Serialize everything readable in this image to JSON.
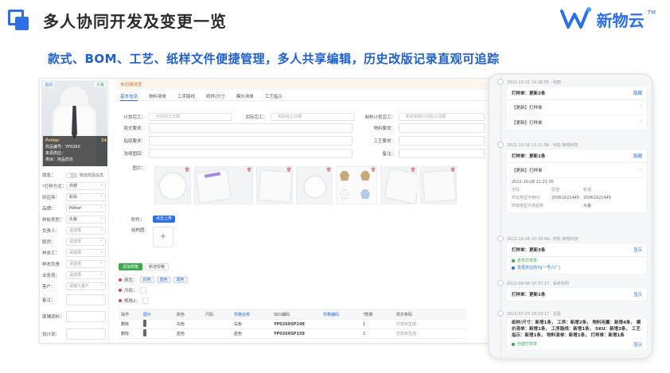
{
  "slide": {
    "title": "多人协同开发及变更一览",
    "subtitle": "款式、BOM、工艺、纸样文件便捷管理，多人共享编辑，历史改版记录直观可追踪",
    "brand": "新物云",
    "brand_tm": "TM"
  },
  "product": {
    "badge_left": "运动",
    "badge_right": "头板",
    "brand_line": "Potter",
    "brand_code": "34",
    "info_lines": [
      "样品编号：YP0260",
      "来源供应：",
      "类目：商品样衣"
    ]
  },
  "left_fields": {
    "switch_label": "修改样品信息",
    "rows": [
      {
        "label": "加急：",
        "value": ""
      },
      {
        "label": "打样方式：",
        "value": "外部"
      },
      {
        "label": "供应商：",
        "value": "彩尚"
      },
      {
        "label": "品牌：",
        "value": "Potter"
      },
      {
        "label": "样板类型：",
        "value": "头板"
      },
      {
        "label": "负责人：",
        "value": "请选择"
      },
      {
        "label": "版师：",
        "value": "请选择"
      },
      {
        "label": "样衣工：",
        "value": "请选择"
      },
      {
        "label": "样衣负责",
        "value": "请选择"
      },
      {
        "label": "业务员：",
        "value": "请选择"
      },
      {
        "label": "客户：",
        "value": "请输入客户"
      },
      {
        "label": "备注：",
        "value": ""
      },
      {
        "label": "面辅资料：",
        "value": ""
      },
      {
        "label": "设计说：",
        "value": ""
      }
    ]
  },
  "main": {
    "draft_notice": "未创建进度",
    "tabs": [
      "基本信息",
      "物料清单",
      "工序路线",
      "纸样/尺寸",
      "模价清单",
      "工艺指示"
    ],
    "form": {
      "plan_finish_label": "计划完工：",
      "plan_finish_placeholder": "计划完工日期",
      "actual_finish_label": "实际完工：",
      "actual_finish_placeholder": "实际完工日期",
      "make_plan_label": "制样计划完工：",
      "make_plan_placeholder": "制定制样计划完工日期",
      "style_req_label": "款式要求：",
      "material_req_label": "物料要求：",
      "pattern_req_label": "贴版要求：",
      "craft_req_label": "工艺要求：",
      "wash_label": "洗唛图回：",
      "remark_label": "备注：",
      "image_label": "图片：",
      "attach_label": "附件：",
      "upload_btn": "点击上传",
      "struct_label": "结构图："
    },
    "spec_tabs": [
      "添加规格",
      "新增规格"
    ],
    "spec_lines": [
      {
        "label": "颜色：",
        "chips": [
          "白色",
          "蓝色",
          "黑色"
        ]
      },
      {
        "label": "尺码：",
        "chips": []
      },
      {
        "label": "规格2：",
        "chips": []
      }
    ],
    "table": {
      "headers": [
        "操作",
        "图片",
        "颜色",
        "尺码",
        "规格名称",
        "SKU编码",
        "规格编码",
        "*数量",
        "样衣条码"
      ],
      "rows": [
        [
          "删除",
          "",
          "白色",
          "",
          "白色",
          "YP0260SP248",
          "",
          "1",
          "打样未生成"
        ],
        [
          "删除",
          "",
          "蓝色",
          "",
          "蓝色",
          "YP0260SP159",
          "",
          "1",
          "打样未生成"
        ]
      ]
    }
  },
  "history": {
    "entries": [
      {
        "date": "2022-10-31 14:38:05 · 张丽",
        "title": "打样单：更新2条",
        "action": "隐藏",
        "items": [
          "【更新】打样单",
          "【更新】打样单"
        ]
      },
      {
        "date": "2022-10-28 11:21:06 · 何松 新物科技",
        "title": "打样单：更新1条",
        "action": "隐藏",
        "item": "【更新】打样单",
        "time": "2022-10-28 11:21:05",
        "kv": [
          [
            "字段",
            "原值",
            "新值"
          ],
          [
            "样衣类型字典ID",
            "25061821440",
            "25061821440"
          ],
          [
            "样板类型字典名称",
            "",
            "头板"
          ]
        ]
      },
      {
        "date": "2022-10-28 10:39:09 · 何松 新物科技",
        "title": "打样单：更新3条",
        "action": "显示",
        "notes": [
          "发布打样单",
          "变更供应商为[一号六厂]"
        ]
      },
      {
        "date": "2022-08-08 10:37:17 · 系统实例",
        "title": "打样单：更新1条",
        "action": "显示"
      },
      {
        "date": "2022-07-29 18:33:17 · 且盈",
        "summary": "纸样/尺寸：新增1条， 工序：新增2条， 物料用量：新增4条， 模价清单：新增1条， 工序路线：新增1条， SKU：新增2条， 工艺指示：新增1条， 物料清单：新增1条， 打样单：新增1条",
        "action": "显示",
        "note": "创建打样单"
      }
    ]
  },
  "colors": {
    "accent": "#2c6fe8",
    "green": "#3aa84b",
    "red": "#e04545",
    "orange": "#e07a2c"
  },
  "icons": [
    "logo-square-icon",
    "brand-logo-icon",
    "switch-icon",
    "chevron-down-icon",
    "chevron-right-icon",
    "delete-icon",
    "plus-icon",
    "drag-handle-icon"
  ]
}
